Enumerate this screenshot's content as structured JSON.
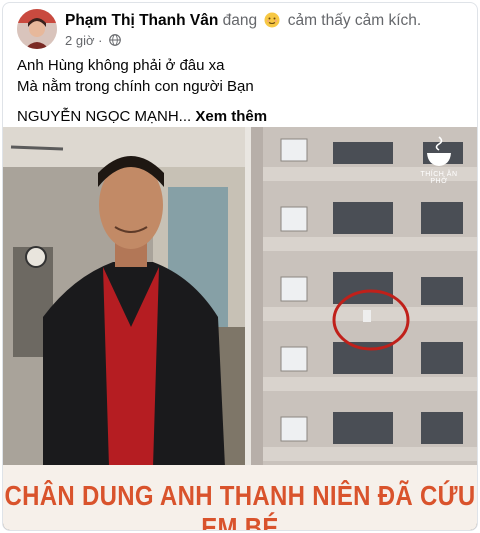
{
  "post": {
    "author_name": "Phạm Thị Thanh Vân",
    "feeling_prefix": "đang",
    "feeling_text": "cảm thấy cảm kích.",
    "timestamp": "2 giờ",
    "privacy_icon": "globe-icon",
    "emoji_icon": "grateful-face-icon",
    "text_lines": [
      "Anh Hùng không phải ở đâu xa",
      "Mà nằm trong chính con người Bạn"
    ],
    "text_tail": "NGUYỄN NGỌC MẠNH...",
    "see_more": "Xem thêm"
  },
  "image": {
    "caption": "CHÂN DUNG ANH THANH NIÊN ĐÃ CỨU EM BÉ",
    "brand": "THÍCH ĂN PHỞ",
    "caption_color": "#d9532c",
    "highlight_circle_color": "#c0201a"
  }
}
